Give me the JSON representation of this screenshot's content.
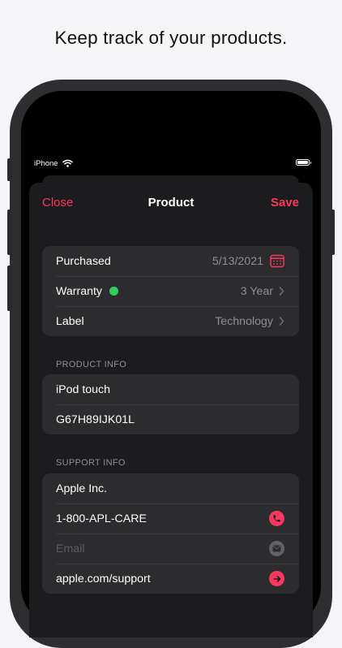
{
  "caption": "Keep track of your products.",
  "status_bar": {
    "carrier": "iPhone"
  },
  "nav": {
    "close_label": "Close",
    "title": "Product",
    "save_label": "Save"
  },
  "details": {
    "purchased": {
      "label": "Purchased",
      "value": "5/13/2021",
      "icon": "calendar-icon"
    },
    "warranty": {
      "label": "Warranty",
      "value": "3 Year",
      "status_color": "#30d158"
    },
    "label": {
      "label": "Label",
      "value": "Technology"
    }
  },
  "product_info": {
    "header": "PRODUCT INFO",
    "name": "iPod touch",
    "serial": "G67H89IJK01L"
  },
  "support_info": {
    "header": "SUPPORT INFO",
    "company": "Apple Inc.",
    "phone": "1-800-APL-CARE",
    "email_placeholder": "Email",
    "website": "apple.com/support"
  },
  "colors": {
    "accent": "#f8385f",
    "background": "#1c1c1e",
    "cell": "#2c2c2e",
    "secondary_text": "#8e8e93"
  }
}
